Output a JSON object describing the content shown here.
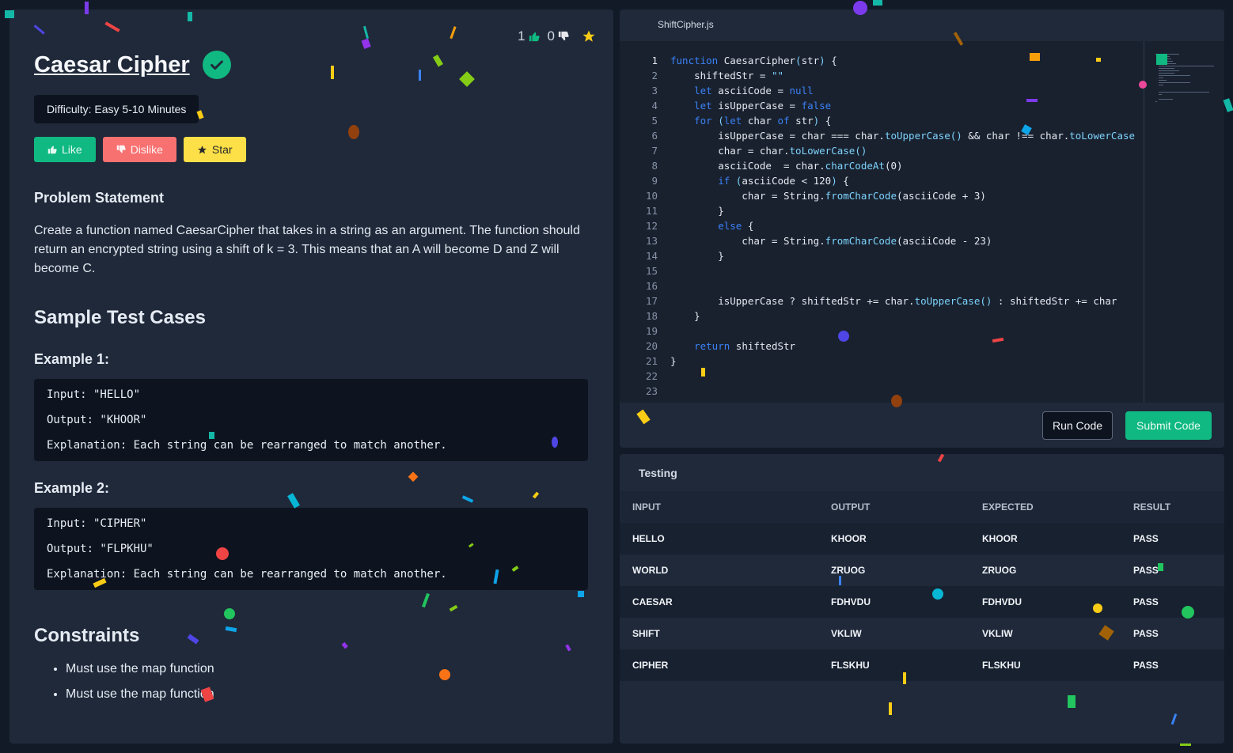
{
  "problem": {
    "title": "Caesar Cipher",
    "likes": "1",
    "dislikes": "0",
    "difficulty": "Difficulty: Easy 5-10 Minutes",
    "buttons": {
      "like": "Like",
      "dislike": "Dislike",
      "star": "Star"
    },
    "statement_heading": "Problem Statement",
    "statement": "Create a function named CaesarCipher that takes in a string as an argument. The function should return an encrypted string using a shift of k = 3. This means that an A will become D and Z will become C.",
    "samples_heading": "Sample Test Cases",
    "examples": [
      {
        "heading": "Example 1:",
        "input": "Input: \"HELLO\"",
        "output": "Output: \"KHOOR\"",
        "explanation": "Explanation: Each string can be rearranged to match another."
      },
      {
        "heading": "Example 2:",
        "input": "Input: \"CIPHER\"",
        "output": "Output: \"FLPKHU\"",
        "explanation": "Explanation: Each string can be rearranged to match another."
      }
    ],
    "constraints_heading": "Constraints",
    "constraints": [
      "Must use the map function",
      "Must use the map function"
    ]
  },
  "editor": {
    "filename": "ShiftCipher.js",
    "line_numbers": [
      "1",
      "2",
      "3",
      "4",
      "5",
      "6",
      "7",
      "8",
      "9",
      "10",
      "11",
      "12",
      "13",
      "14",
      "15",
      "16",
      "17",
      "18",
      "19",
      "20",
      "21",
      "22",
      "23"
    ],
    "run_label": "Run Code",
    "submit_label": "Submit Code"
  },
  "testing": {
    "title": "Testing",
    "headers": [
      "INPUT",
      "OUTPUT",
      "EXPECTED",
      "RESULT"
    ],
    "rows": [
      [
        "HELLO",
        "KHOOR",
        "KHOOR",
        "PASS"
      ],
      [
        "WORLD",
        "ZRUOG",
        "ZRUOG",
        "PASS"
      ],
      [
        "CAESAR",
        "FDHVDU",
        "FDHVDU",
        "PASS"
      ],
      [
        "SHIFT",
        "VKLIW",
        "VKLIW",
        "PASS"
      ],
      [
        "CIPHER",
        "FLSKHU",
        "FLSKHU",
        "PASS"
      ]
    ]
  },
  "colors": {
    "accent": "#10b981",
    "dislike": "#f87171",
    "star": "#fde047",
    "keyword": "#3b82f6",
    "function": "#7dd3fc"
  }
}
